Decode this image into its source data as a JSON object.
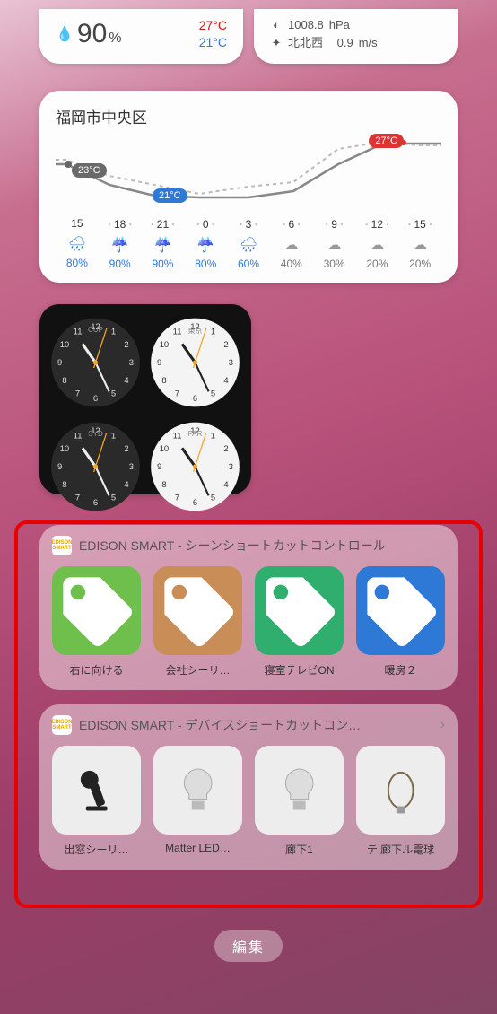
{
  "top": {
    "humidity": "90",
    "humidity_unit": "%",
    "temp_hi": "27",
    "temp_lo": "21",
    "temp_unit": "°C",
    "pressure_value": "1008.8",
    "pressure_unit": "hPa",
    "wind_dir": "北北西",
    "wind_speed": "0.9",
    "wind_unit": "m/s"
  },
  "forecast": {
    "location": "福岡市中央区",
    "badge_now_temp": "23°C",
    "badge_low_temp": "21°C",
    "badge_hi_temp": "27°C",
    "hours": [
      {
        "h": "15",
        "icon": "rain-light",
        "pop": "80%",
        "blue": true
      },
      {
        "h": "18",
        "icon": "umbrella",
        "pop": "90%",
        "blue": true
      },
      {
        "h": "21",
        "icon": "umbrella",
        "pop": "90%",
        "blue": true
      },
      {
        "h": "0",
        "icon": "umbrella",
        "pop": "80%",
        "blue": true
      },
      {
        "h": "3",
        "icon": "rain-light",
        "pop": "60%",
        "blue": true
      },
      {
        "h": "6",
        "icon": "cloud",
        "pop": "40%",
        "blue": false
      },
      {
        "h": "9",
        "icon": "cloud",
        "pop": "30%",
        "blue": false
      },
      {
        "h": "12",
        "icon": "cloud",
        "pop": "20%",
        "blue": false
      },
      {
        "h": "15",
        "icon": "cloud",
        "pop": "20%",
        "blue": false
      }
    ]
  },
  "clocks": [
    {
      "city": "CUP",
      "style": "dark"
    },
    {
      "city": "東京",
      "style": "light"
    },
    {
      "city": "SYD",
      "style": "dark"
    },
    {
      "city": "PAR",
      "style": "light"
    }
  ],
  "edison_logo_text": "EDISON SMART",
  "scene_card": {
    "title": "EDISON SMART - シーンショートカットコントロール",
    "items": [
      {
        "label": "右に向ける",
        "color": "#6EBF4B"
      },
      {
        "label": "会社シーリ…",
        "color": "#C98E58"
      },
      {
        "label": "寝室テレビON",
        "color": "#2FAE6E"
      },
      {
        "label": "暖房２",
        "color": "#2E78D6"
      }
    ]
  },
  "device_card": {
    "title": "EDISON SMART - デバイスショートカットコン…",
    "items": [
      {
        "label": "出窓シーリ…",
        "icon": "spotlight"
      },
      {
        "label": "Matter LED…",
        "icon": "bulb"
      },
      {
        "label": "廊下1",
        "icon": "bulb"
      },
      {
        "label": "テ 廊下ル電球",
        "icon": "bulb-edison"
      }
    ]
  },
  "edit_label": "編集",
  "chart_data": {
    "type": "line",
    "title": "福岡市中央区",
    "x_categories": [
      "15",
      "18",
      "21",
      "0",
      "3",
      "6",
      "9",
      "12",
      "15"
    ],
    "series": [
      {
        "name": "forecast_temp",
        "values": [
          23,
          22,
          21,
          21,
          21,
          22,
          25,
          27,
          27
        ]
      },
      {
        "name": "past_reference",
        "values": [
          24,
          23,
          22,
          21,
          22,
          23,
          26,
          27,
          27
        ]
      }
    ],
    "ylabel": "°C",
    "annotations": [
      {
        "x": "15",
        "y": 23,
        "text": "23°C",
        "color": "gray"
      },
      {
        "x": "21",
        "y": 21,
        "text": "21°C",
        "color": "blue"
      },
      {
        "x": "12",
        "y": 27,
        "text": "27°C",
        "color": "red"
      }
    ],
    "precip_prob": [
      80,
      90,
      90,
      80,
      60,
      40,
      30,
      20,
      20
    ]
  }
}
